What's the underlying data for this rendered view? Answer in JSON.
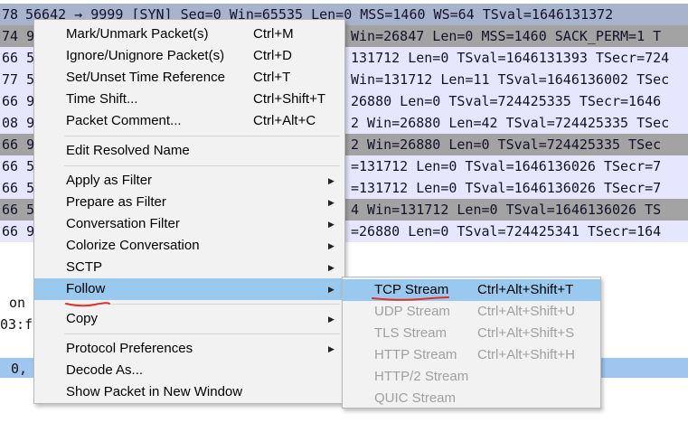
{
  "packets": [
    {
      "prefix": "78",
      "text": "56642 → 9999 [SYN] Seq=0 Win=65535 Len=0 MSS=1460 WS=64 TSval=1646131372",
      "style": "selected",
      "text_left": 28
    },
    {
      "prefix": "74 9",
      "text": "Win=26847 Len=0 MSS=1460 SACK_PERM=1 T",
      "style": "dark",
      "text_left": 388
    },
    {
      "prefix": "66 5",
      "text": "131712 Len=0 TSval=1646131393 TSecr=724",
      "style": "light",
      "text_left": 388
    },
    {
      "prefix": "77 5",
      "text": "Win=131712 Len=11 TSval=1646136002 TSec",
      "style": "light",
      "text_left": 388
    },
    {
      "prefix": "66 9",
      "text": "26880 Len=0 TSval=724425335 TSecr=1646",
      "style": "light",
      "text_left": 388
    },
    {
      "prefix": "08 9",
      "text": "2 Win=26880 Len=42 TSval=724425335 TSec",
      "style": "light",
      "text_left": 388
    },
    {
      "prefix": "66 9",
      "text": "2 Win=26880 Len=0 TSval=724425335 TSec",
      "style": "dark",
      "text_left": 388
    },
    {
      "prefix": "66 5",
      "text": "=131712 Len=0 TSval=1646136026 TSecr=7",
      "style": "light",
      "text_left": 388
    },
    {
      "prefix": "66 5",
      "text": "=131712 Len=0 TSval=1646136026 TSecr=7",
      "style": "light",
      "text_left": 388
    },
    {
      "prefix": "66 5",
      "text": "4 Win=131712 Len=0 TSval=1646136026 TS",
      "style": "dark",
      "text_left": 388
    },
    {
      "prefix": "66 9",
      "text": "=26880 Len=0 TSval=724425341 TSecr=164",
      "style": "light",
      "text_left": 388
    }
  ],
  "details": {
    "line1": "on",
    "line2": "03:f",
    "line3": "0,"
  },
  "menu": {
    "items": [
      {
        "label": "Mark/Unmark Packet(s)",
        "shortcut": "Ctrl+M"
      },
      {
        "label": "Ignore/Unignore Packet(s)",
        "shortcut": "Ctrl+D"
      },
      {
        "label": "Set/Unset Time Reference",
        "shortcut": "Ctrl+T"
      },
      {
        "label": "Time Shift...",
        "shortcut": "Ctrl+Shift+T"
      },
      {
        "label": "Packet Comment...",
        "shortcut": "Ctrl+Alt+C"
      },
      {
        "label": "Edit Resolved Name",
        "shortcut": ""
      },
      {
        "label": "Apply as Filter",
        "shortcut": ""
      },
      {
        "label": "Prepare as Filter",
        "shortcut": ""
      },
      {
        "label": "Conversation Filter",
        "shortcut": ""
      },
      {
        "label": "Colorize Conversation",
        "shortcut": ""
      },
      {
        "label": "SCTP",
        "shortcut": ""
      },
      {
        "label": "Follow",
        "shortcut": ""
      },
      {
        "label": "Copy",
        "shortcut": ""
      },
      {
        "label": "Protocol Preferences",
        "shortcut": ""
      },
      {
        "label": "Decode As...",
        "shortcut": ""
      },
      {
        "label": "Show Packet in New Window",
        "shortcut": ""
      }
    ]
  },
  "submenu": {
    "items": [
      {
        "label": "TCP Stream",
        "shortcut": "Ctrl+Alt+Shift+T",
        "enabled": true
      },
      {
        "label": "UDP Stream",
        "shortcut": "Ctrl+Alt+Shift+U",
        "enabled": false
      },
      {
        "label": "TLS Stream",
        "shortcut": "Ctrl+Alt+Shift+S",
        "enabled": false
      },
      {
        "label": "HTTP Stream",
        "shortcut": "Ctrl+Alt+Shift+H",
        "enabled": false
      },
      {
        "label": "HTTP/2 Stream",
        "shortcut": "",
        "enabled": false
      },
      {
        "label": "QUIC Stream",
        "shortcut": "",
        "enabled": false
      }
    ]
  },
  "colors": {
    "highlight": "#99c9ef",
    "annotation": "#e0302a",
    "selected_row": "#a8b4cc",
    "dark_row": "#a3a3a3",
    "light_row": "#e7e6ff"
  }
}
